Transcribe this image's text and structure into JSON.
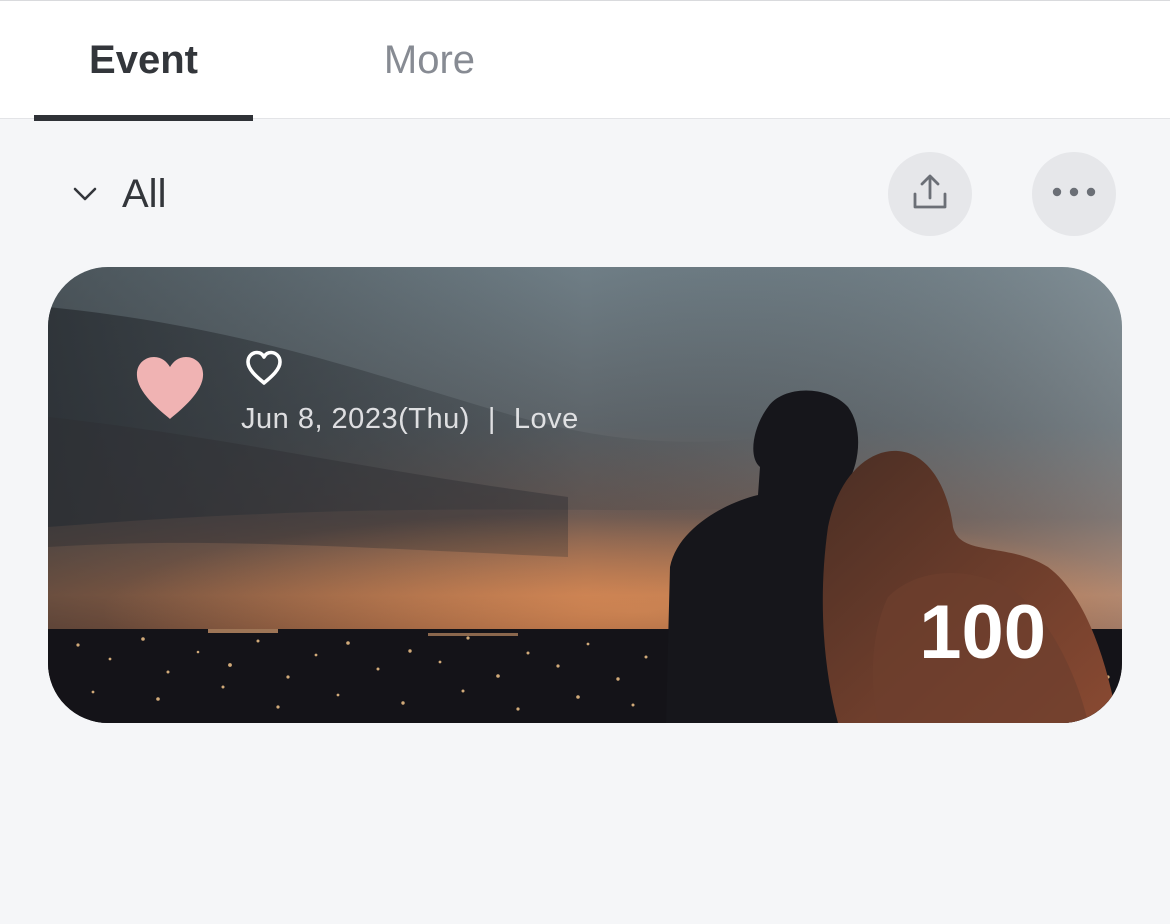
{
  "tabs": {
    "event_label": "Event",
    "more_label": "More",
    "active": "event"
  },
  "filter": {
    "label": "All",
    "icon": "chevron-down-icon"
  },
  "actions": {
    "share_icon": "share-upload-icon",
    "more_icon": "more-horizontal-icon"
  },
  "event_card": {
    "category_icon": "heart-filled-icon",
    "favorite_icon": "heart-outline-icon",
    "date": "Jun 8, 2023(Thu)",
    "separator": "|",
    "category": "Love",
    "count": "100",
    "background_image": "couple-at-sunset-city-photo"
  },
  "colors": {
    "heart_pink": "#f0b3b3",
    "text_dark": "#33363b",
    "text_muted": "#878b93",
    "background": "#f5f6f8",
    "button_bg": "#e6e7ea"
  }
}
